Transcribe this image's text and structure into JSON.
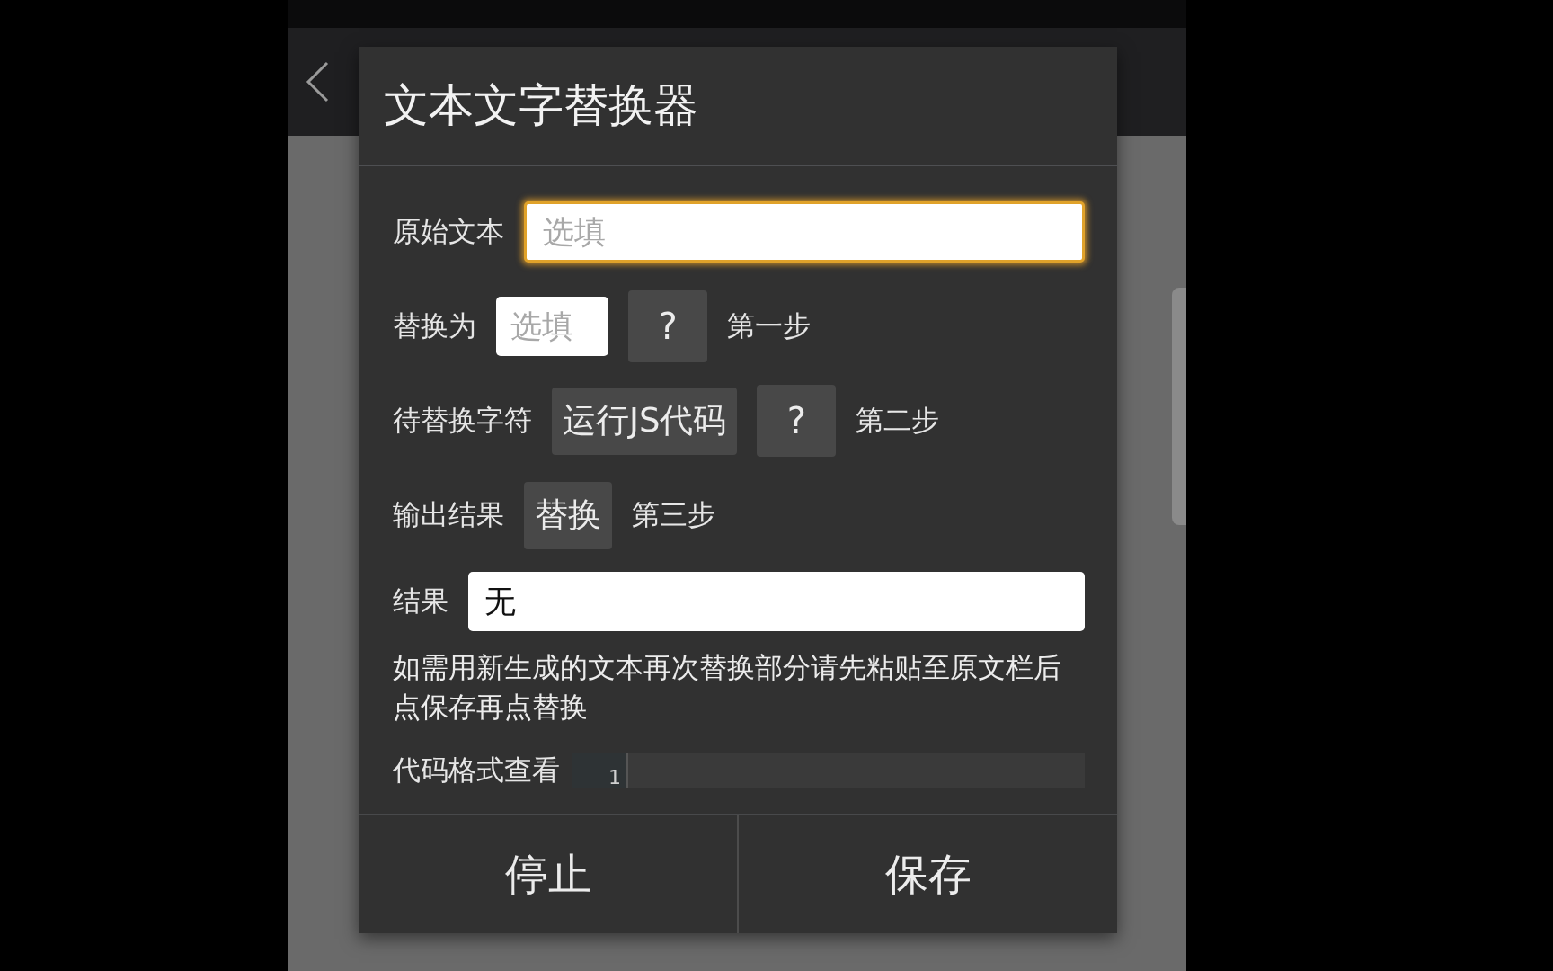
{
  "dialog": {
    "title": "文本文字替换器",
    "rows": [
      {
        "kind": "wide",
        "label": "原始文本",
        "placeholder": "选填",
        "focused": true
      },
      {
        "kind": "short",
        "label": "替换为",
        "placeholder": "选填",
        "help": "?",
        "step": "第一步"
      },
      {
        "kind": "action",
        "label": "待替换字符",
        "button": "运行JS代码",
        "help": "?",
        "step": "第二步"
      },
      {
        "kind": "action",
        "label": "输出结果",
        "button": "替换",
        "step": "第三步"
      },
      {
        "kind": "result",
        "label": "结果",
        "value": "无"
      }
    ],
    "note": "如需用新生成的文本再次替换部分请先粘贴至原文栏后点保存再点替换",
    "code_view": {
      "label": "代码格式查看",
      "line_numbers": [
        "1"
      ]
    },
    "buttons": [
      "停止",
      "保存"
    ]
  }
}
